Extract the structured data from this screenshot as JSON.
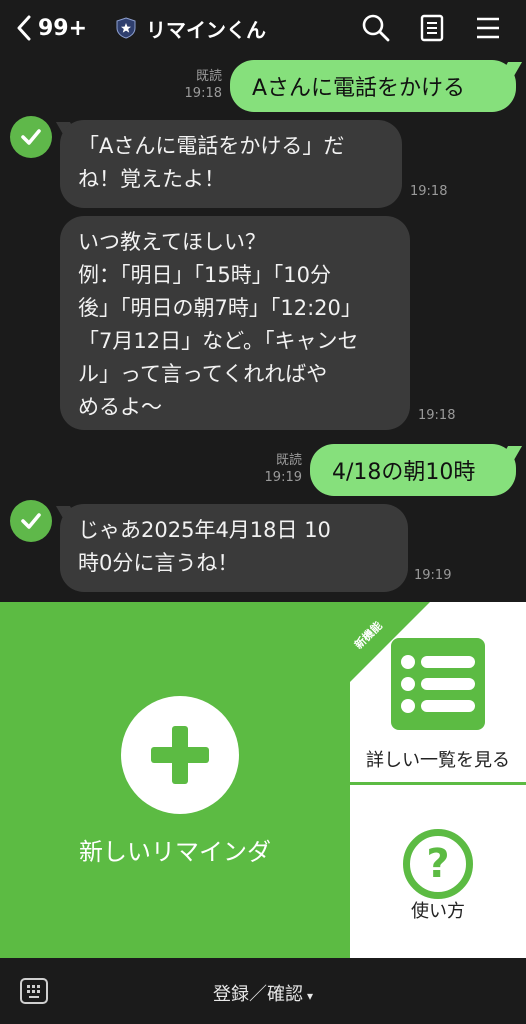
{
  "header": {
    "back_count": "99+",
    "title": "リマインくん",
    "icons": [
      "chevron-left-icon",
      "shield-icon",
      "search-icon",
      "note-icon",
      "menu-icon"
    ]
  },
  "messages": [
    {
      "id": "m1",
      "type": "out",
      "text": "Aさんに電話をかける",
      "read": "既読",
      "time": "19:18"
    },
    {
      "id": "m2",
      "type": "in",
      "lines": [
        "「Aさんに電話をかける」だ",
        "ね！覚えたよ！"
      ],
      "time": "19:18"
    },
    {
      "id": "m3",
      "type": "in",
      "lines": [
        "いつ教えてほしい？",
        "例：「明日」「15時」「10分",
        "後」「明日の朝7時」「12:20」",
        "「7月12日」など。「キャンセ",
        "ル」って言ってくれればや",
        "めるよ〜"
      ],
      "time": "19:18"
    },
    {
      "id": "m4",
      "type": "out",
      "text": "4/18の朝10時",
      "read": "既読",
      "time": "19:19"
    },
    {
      "id": "m5",
      "type": "in",
      "lines": [
        "じゃあ2025年4月18日 10",
        "時0分に言うね！"
      ],
      "time": "19:19"
    }
  ],
  "richmenu": {
    "new_reminder": "新しいリマインダ",
    "list_view": "詳しい一覧を見る",
    "new_badge": "新機能",
    "how_to": "使い方",
    "help_glyph": "?",
    "accent_color": "#5cbb43"
  },
  "bottombar": {
    "toggle_label": "登録／確認",
    "caret": "▾"
  }
}
